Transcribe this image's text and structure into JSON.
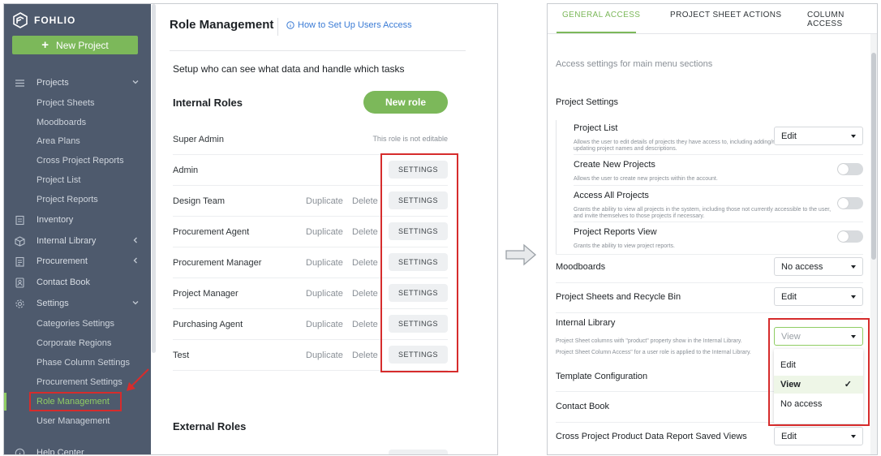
{
  "sidebar": {
    "logo_text": "FOHLIO",
    "new_project_label": "New Project",
    "items": [
      {
        "label": "Projects",
        "icon": "menu-icon",
        "chevron": "down"
      },
      {
        "label": "Project Sheets"
      },
      {
        "label": "Moodboards"
      },
      {
        "label": "Area Plans"
      },
      {
        "label": "Cross Project Reports"
      },
      {
        "label": "Project List"
      },
      {
        "label": "Project Reports"
      },
      {
        "label": "Inventory",
        "icon": "inventory-icon"
      },
      {
        "label": "Internal Library",
        "icon": "box-icon",
        "chevron": "left"
      },
      {
        "label": "Procurement",
        "icon": "clipboard-icon",
        "chevron": "left"
      },
      {
        "label": "Contact Book",
        "icon": "contact-icon"
      },
      {
        "label": "Settings",
        "icon": "gear-icon",
        "chevron": "down"
      },
      {
        "label": "Categories Settings"
      },
      {
        "label": "Corporate Regions"
      },
      {
        "label": "Phase Column Settings"
      },
      {
        "label": "Procurement Settings"
      },
      {
        "label": "Role Management",
        "active": true
      },
      {
        "label": "User Management"
      },
      {
        "label": "Help Center",
        "icon": "info-icon"
      }
    ]
  },
  "role_management": {
    "title": "Role Management",
    "help_link": "How to Set Up Users Access",
    "intro": "Setup who can see what data and handle which tasks",
    "internal_roles_title": "Internal Roles",
    "new_role_label": "New role",
    "external_roles_title": "External Roles",
    "not_editable_note": "This role is not editable",
    "duplicate_label": "Duplicate",
    "delete_label": "Delete",
    "settings_label": "SETTINGS",
    "roles": [
      {
        "name": "Super Admin",
        "editable": false
      },
      {
        "name": "Admin",
        "editable": true,
        "actions": false
      },
      {
        "name": "Design Team",
        "editable": true,
        "actions": true
      },
      {
        "name": "Procurement Agent",
        "editable": true,
        "actions": true
      },
      {
        "name": "Procurement Manager",
        "editable": true,
        "actions": true
      },
      {
        "name": "Project Manager",
        "editable": true,
        "actions": true
      },
      {
        "name": "Purchasing Agent",
        "editable": true,
        "actions": true
      },
      {
        "name": "Test",
        "editable": true,
        "actions": true
      }
    ]
  },
  "access": {
    "tabs": [
      "GENERAL ACCESS",
      "PROJECT SHEET ACTIONS",
      "COLUMN ACCESS"
    ],
    "active_tab": 0,
    "subtitle": "Access settings for main menu sections",
    "project_settings_label": "Project Settings",
    "project_list": {
      "label": "Project List",
      "desc": "Allows the user to edit details of projects they have access to, including adding/removing users and updating project names and descriptions.",
      "value": "Edit"
    },
    "create_new_projects": {
      "label": "Create New Projects",
      "desc": "Allows the user to create new projects within the account."
    },
    "access_all_projects": {
      "label": "Access All Projects",
      "desc": "Grants the ability to view all projects in the system, including those not currently accessible to the user, and invite themselves to those projects if necessary."
    },
    "project_reports_view": {
      "label": "Project Reports View",
      "desc": "Grants the ability to view project reports."
    },
    "moodboards": {
      "label": "Moodboards",
      "value": "No access"
    },
    "project_sheets": {
      "label": "Project Sheets and Recycle Bin",
      "value": "Edit"
    },
    "internal_library": {
      "label": "Internal Library",
      "desc1": "Project Sheet columns with \"product\" property show in the Internal Library.",
      "desc2": "Project Sheet Column Access\" for a user role is applied to the Internal Library.",
      "value": "View",
      "options": [
        "Edit",
        "View",
        "No access"
      ],
      "selected": "View",
      "check": "✓"
    },
    "template_configuration": {
      "label": "Template Configuration"
    },
    "contact_book": {
      "label": "Contact Book"
    },
    "cross_project_report": {
      "label": "Cross Project Product Data Report Saved Views",
      "value": "Edit"
    }
  },
  "colors": {
    "sidebar_bg": "#4e5a6d",
    "accent_green": "#7cb85a",
    "active_nav": "#8fcd63",
    "highlight_red": "#d62c2c",
    "link_blue": "#3a7bd5"
  }
}
